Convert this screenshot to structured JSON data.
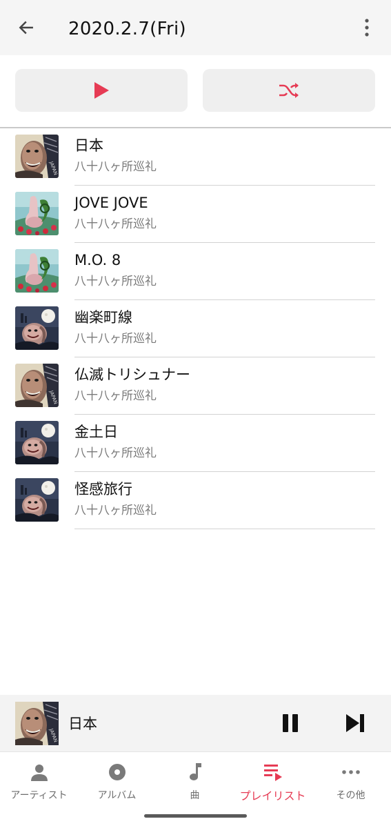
{
  "header": {
    "title": "2020.2.7(Fri)",
    "back_icon": "back-arrow-icon",
    "more_icon": "more-vertical-icon"
  },
  "actions": {
    "play_icon": "play-icon",
    "shuffle_icon": "shuffle-icon",
    "accent_color": "#e63b54"
  },
  "tracks": [
    {
      "title": "日本",
      "album": "八十八ヶ所巡礼",
      "art": "album-art-face"
    },
    {
      "title": "JOVE JOVE",
      "album": "八十八ヶ所巡礼",
      "art": "album-art-figure"
    },
    {
      "title": "M.O. 8",
      "album": "八十八ヶ所巡礼",
      "art": "album-art-figure"
    },
    {
      "title": "幽楽町線",
      "album": "八十八ヶ所巡礼",
      "art": "album-art-moon"
    },
    {
      "title": "仏滅トリシュナー",
      "album": "八十八ヶ所巡礼",
      "art": "album-art-face"
    },
    {
      "title": "金土日",
      "album": "八十八ヶ所巡礼",
      "art": "album-art-moon"
    },
    {
      "title": "怪感旅行",
      "album": "八十八ヶ所巡礼",
      "art": "album-art-moon"
    }
  ],
  "now_playing": {
    "title": "日本",
    "pause_icon": "pause-icon",
    "next_icon": "skip-next-icon"
  },
  "nav": {
    "items": [
      {
        "label": "アーティスト",
        "icon": "person-icon",
        "active": false
      },
      {
        "label": "アルバム",
        "icon": "disc-icon",
        "active": false
      },
      {
        "label": "曲",
        "icon": "music-note-icon",
        "active": false
      },
      {
        "label": "プレイリスト",
        "icon": "playlist-icon",
        "active": true
      },
      {
        "label": "その他",
        "icon": "more-horizontal-icon",
        "active": false
      }
    ]
  }
}
